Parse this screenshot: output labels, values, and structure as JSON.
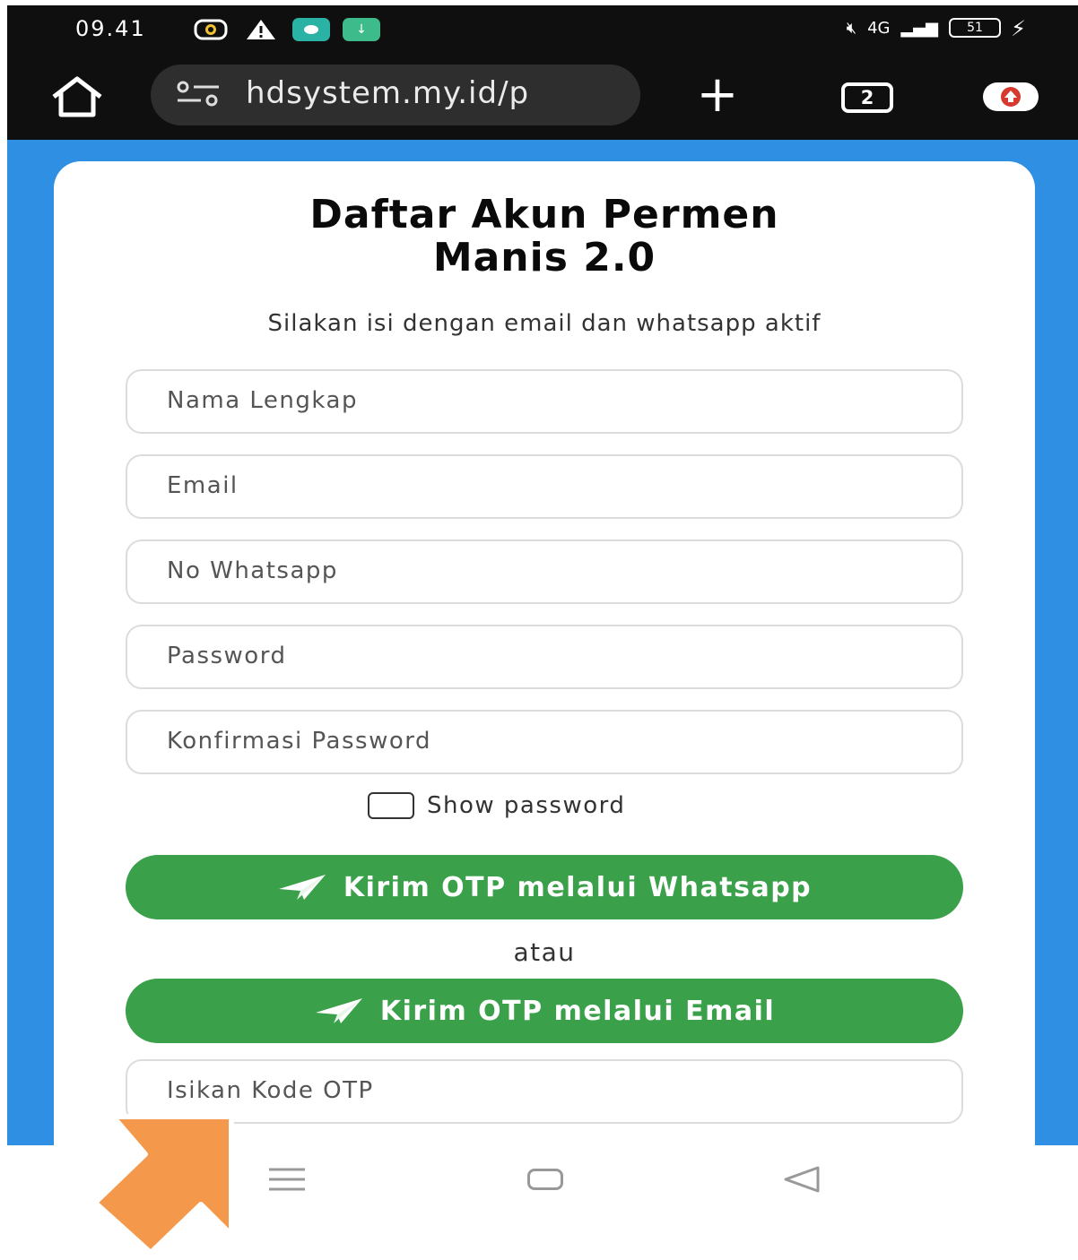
{
  "status_bar": {
    "time": "09.41",
    "network": "4G",
    "battery": "51",
    "app_icons": [
      {
        "name": "record-app-icon",
        "color": "#ffffff"
      },
      {
        "name": "warning-icon",
        "color": "#ffffff"
      },
      {
        "name": "teal-app-icon",
        "color": "#2ab3a5"
      },
      {
        "name": "download-app-icon",
        "color": "#3dbb8a"
      }
    ]
  },
  "browser": {
    "url": "hdsystem.my.id/p",
    "tab_count": "2",
    "icons": [
      "home-icon",
      "site-settings-icon",
      "new-tab-icon",
      "tabs-icon",
      "update-icon"
    ]
  },
  "page": {
    "title_line1": "Daftar Akun Permen",
    "title_line2": "Manis 2.0",
    "subtitle": "Silakan isi dengan email dan whatsapp aktif",
    "fields": {
      "name": "Nama Lengkap",
      "email": "Email",
      "whatsapp": "No Whatsapp",
      "password": "Password",
      "confirm_password": "Konfirmasi Password",
      "otp_code": "Isikan Kode OTP"
    },
    "show_password_label": "Show password",
    "show_password_checked": false,
    "otp_whatsapp_button": "Kirim OTP melalui Whatsapp",
    "separator": "atau",
    "otp_email_button": "Kirim OTP melalui Email"
  },
  "colors": {
    "page_bg": "#2f8fe3",
    "button_green": "#3aa14a",
    "annotation_arrow": "#f4994b",
    "browser_bar": "#0f0f0f"
  }
}
